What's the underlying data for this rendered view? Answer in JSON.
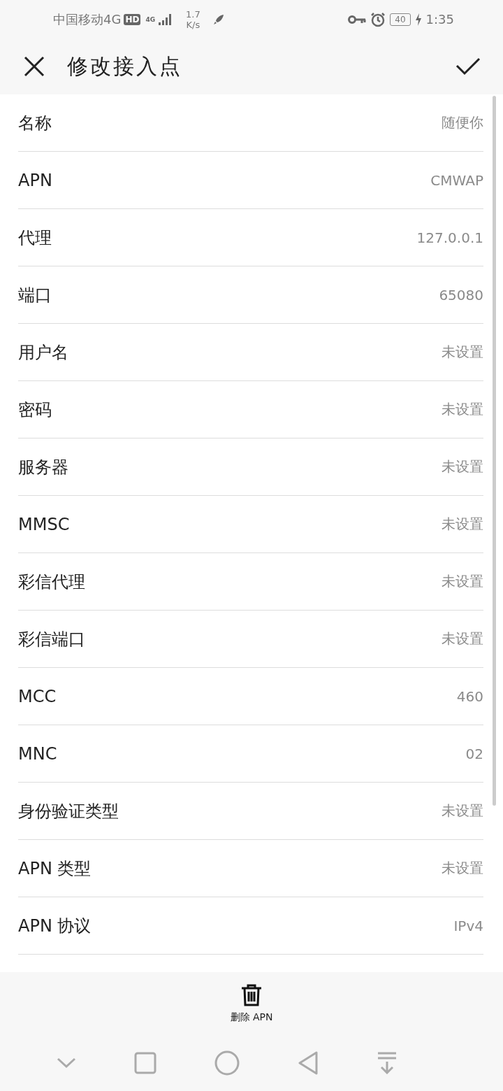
{
  "status_bar": {
    "carrier": "中国移动4G",
    "hd_badge": "HD",
    "network": "4G",
    "speed_value": "1.7",
    "speed_unit": "K/s",
    "battery": "40",
    "time": "1:35"
  },
  "header": {
    "title": "修改接入点"
  },
  "fields": [
    {
      "label": "名称",
      "value": "随便你"
    },
    {
      "label": "APN",
      "value": "CMWAP"
    },
    {
      "label": "代理",
      "value": "127.0.0.1"
    },
    {
      "label": "端口",
      "value": "65080"
    },
    {
      "label": "用户名",
      "value": "未设置"
    },
    {
      "label": "密码",
      "value": "未设置"
    },
    {
      "label": "服务器",
      "value": "未设置"
    },
    {
      "label": "MMSC",
      "value": "未设置"
    },
    {
      "label": "彩信代理",
      "value": "未设置"
    },
    {
      "label": "彩信端口",
      "value": "未设置"
    },
    {
      "label": "MCC",
      "value": "460"
    },
    {
      "label": "MNC",
      "value": "02"
    },
    {
      "label": "身份验证类型",
      "value": "未设置"
    },
    {
      "label": "APN 类型",
      "value": "未设置"
    },
    {
      "label": "APN 协议",
      "value": "IPv4"
    }
  ],
  "bottom_action": {
    "label": "删除 APN"
  }
}
